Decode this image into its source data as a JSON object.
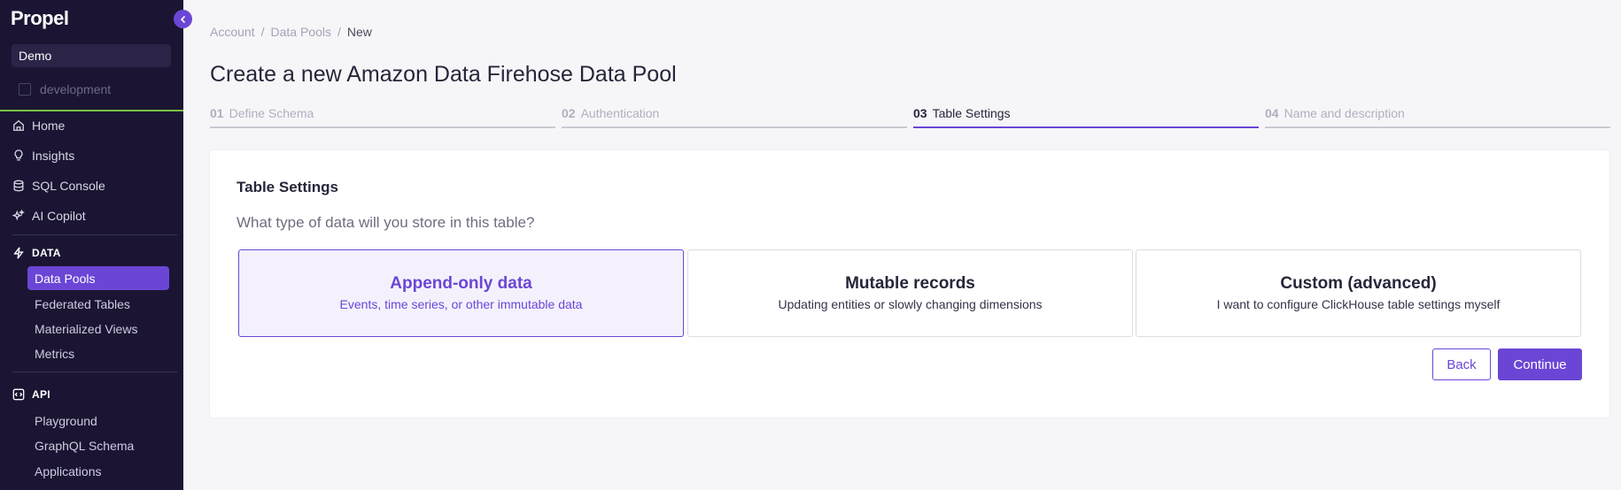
{
  "sidebar": {
    "logo": "Propel",
    "org": "Demo",
    "environment": "development",
    "nav": [
      {
        "label": "Home",
        "icon": "home-icon"
      },
      {
        "label": "Insights",
        "icon": "lightbulb-icon"
      },
      {
        "label": "SQL Console",
        "icon": "database-icon"
      },
      {
        "label": "AI Copilot",
        "icon": "sparkles-icon"
      }
    ],
    "data_section": {
      "label": "DATA",
      "items": [
        "Data Pools",
        "Federated Tables",
        "Materialized Views",
        "Metrics"
      ],
      "active": "Data Pools"
    },
    "api_section": {
      "label": "API",
      "items": [
        "Playground",
        "GraphQL Schema",
        "Applications"
      ]
    }
  },
  "breadcrumb": {
    "items": [
      "Account",
      "Data Pools",
      "New"
    ],
    "separator": "/"
  },
  "page": {
    "title": "Create a new Amazon Data Firehose Data Pool"
  },
  "steps": [
    {
      "num": "01",
      "label": "Define Schema",
      "state": "inactive"
    },
    {
      "num": "02",
      "label": "Authentication",
      "state": "inactive"
    },
    {
      "num": "03",
      "label": "Table Settings",
      "state": "active"
    },
    {
      "num": "04",
      "label": "Name and description",
      "state": "inactive"
    }
  ],
  "card": {
    "title": "Table Settings",
    "question": "What type of data will you store in this table?",
    "options": [
      {
        "title": "Append-only data",
        "description": "Events, time series, or other immutable data",
        "selected": true
      },
      {
        "title": "Mutable records",
        "description": "Updating entities or slowly changing dimensions",
        "selected": false
      },
      {
        "title": "Custom (advanced)",
        "description": "I want to configure ClickHouse table settings myself",
        "selected": false
      }
    ],
    "back_label": "Back",
    "continue_label": "Continue"
  },
  "colors": {
    "accent": "#6b46d6",
    "sidebar_bg": "#1b1533",
    "env_bar": "#7bc043"
  }
}
